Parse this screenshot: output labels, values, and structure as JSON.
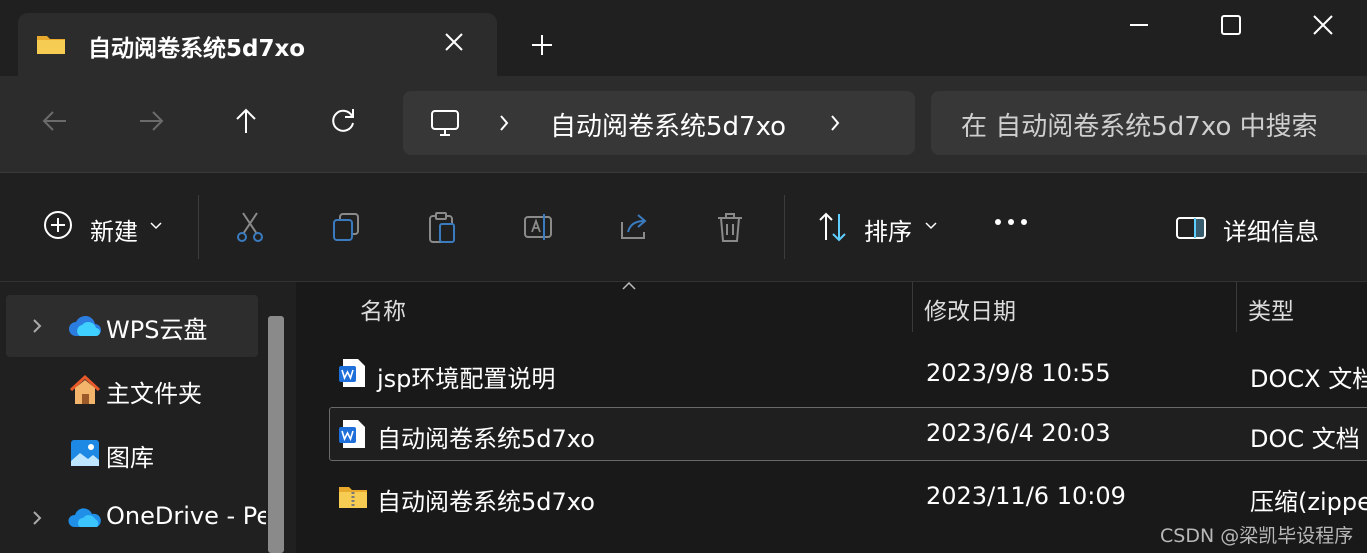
{
  "tab": {
    "title": "自动阅卷系统5d7xo"
  },
  "address": {
    "path_item": "自动阅卷系统5d7xo"
  },
  "search": {
    "placeholder": "在 自动阅卷系统5d7xo 中搜索"
  },
  "commands": {
    "new_label": "新建",
    "sort_label": "排序",
    "details_label": "详细信息"
  },
  "sidebar": {
    "items": [
      {
        "label": "WPS云盘",
        "icon": "cloud-icon",
        "expandable": true,
        "selected": true
      },
      {
        "label": "主文件夹",
        "icon": "home-icon",
        "expandable": false,
        "selected": false
      },
      {
        "label": "图库",
        "icon": "gallery-icon",
        "expandable": false,
        "selected": false
      },
      {
        "label": "OneDrive - Pe",
        "icon": "onedrive-icon",
        "expandable": true,
        "selected": false
      }
    ]
  },
  "columns": {
    "name": "名称",
    "modified": "修改日期",
    "type": "类型"
  },
  "files": [
    {
      "name": "jsp环境配置说明",
      "modified": "2023/9/8 10:55",
      "type": "DOCX 文档",
      "icon": "word-doc-icon"
    },
    {
      "name": "自动阅卷系统5d7xo",
      "modified": "2023/6/4 20:03",
      "type": "DOC 文档",
      "icon": "word-doc-icon",
      "selected": true
    },
    {
      "name": "自动阅卷系统5d7xo",
      "modified": "2023/11/6 10:09",
      "type": "压缩(zipped)",
      "icon": "zip-folder-icon"
    }
  ],
  "watermark": "CSDN @梁凯毕设程序",
  "colors": {
    "background": "#191919",
    "accent_blue": "#60cdff",
    "folder_yellow": "#f5c64a"
  }
}
